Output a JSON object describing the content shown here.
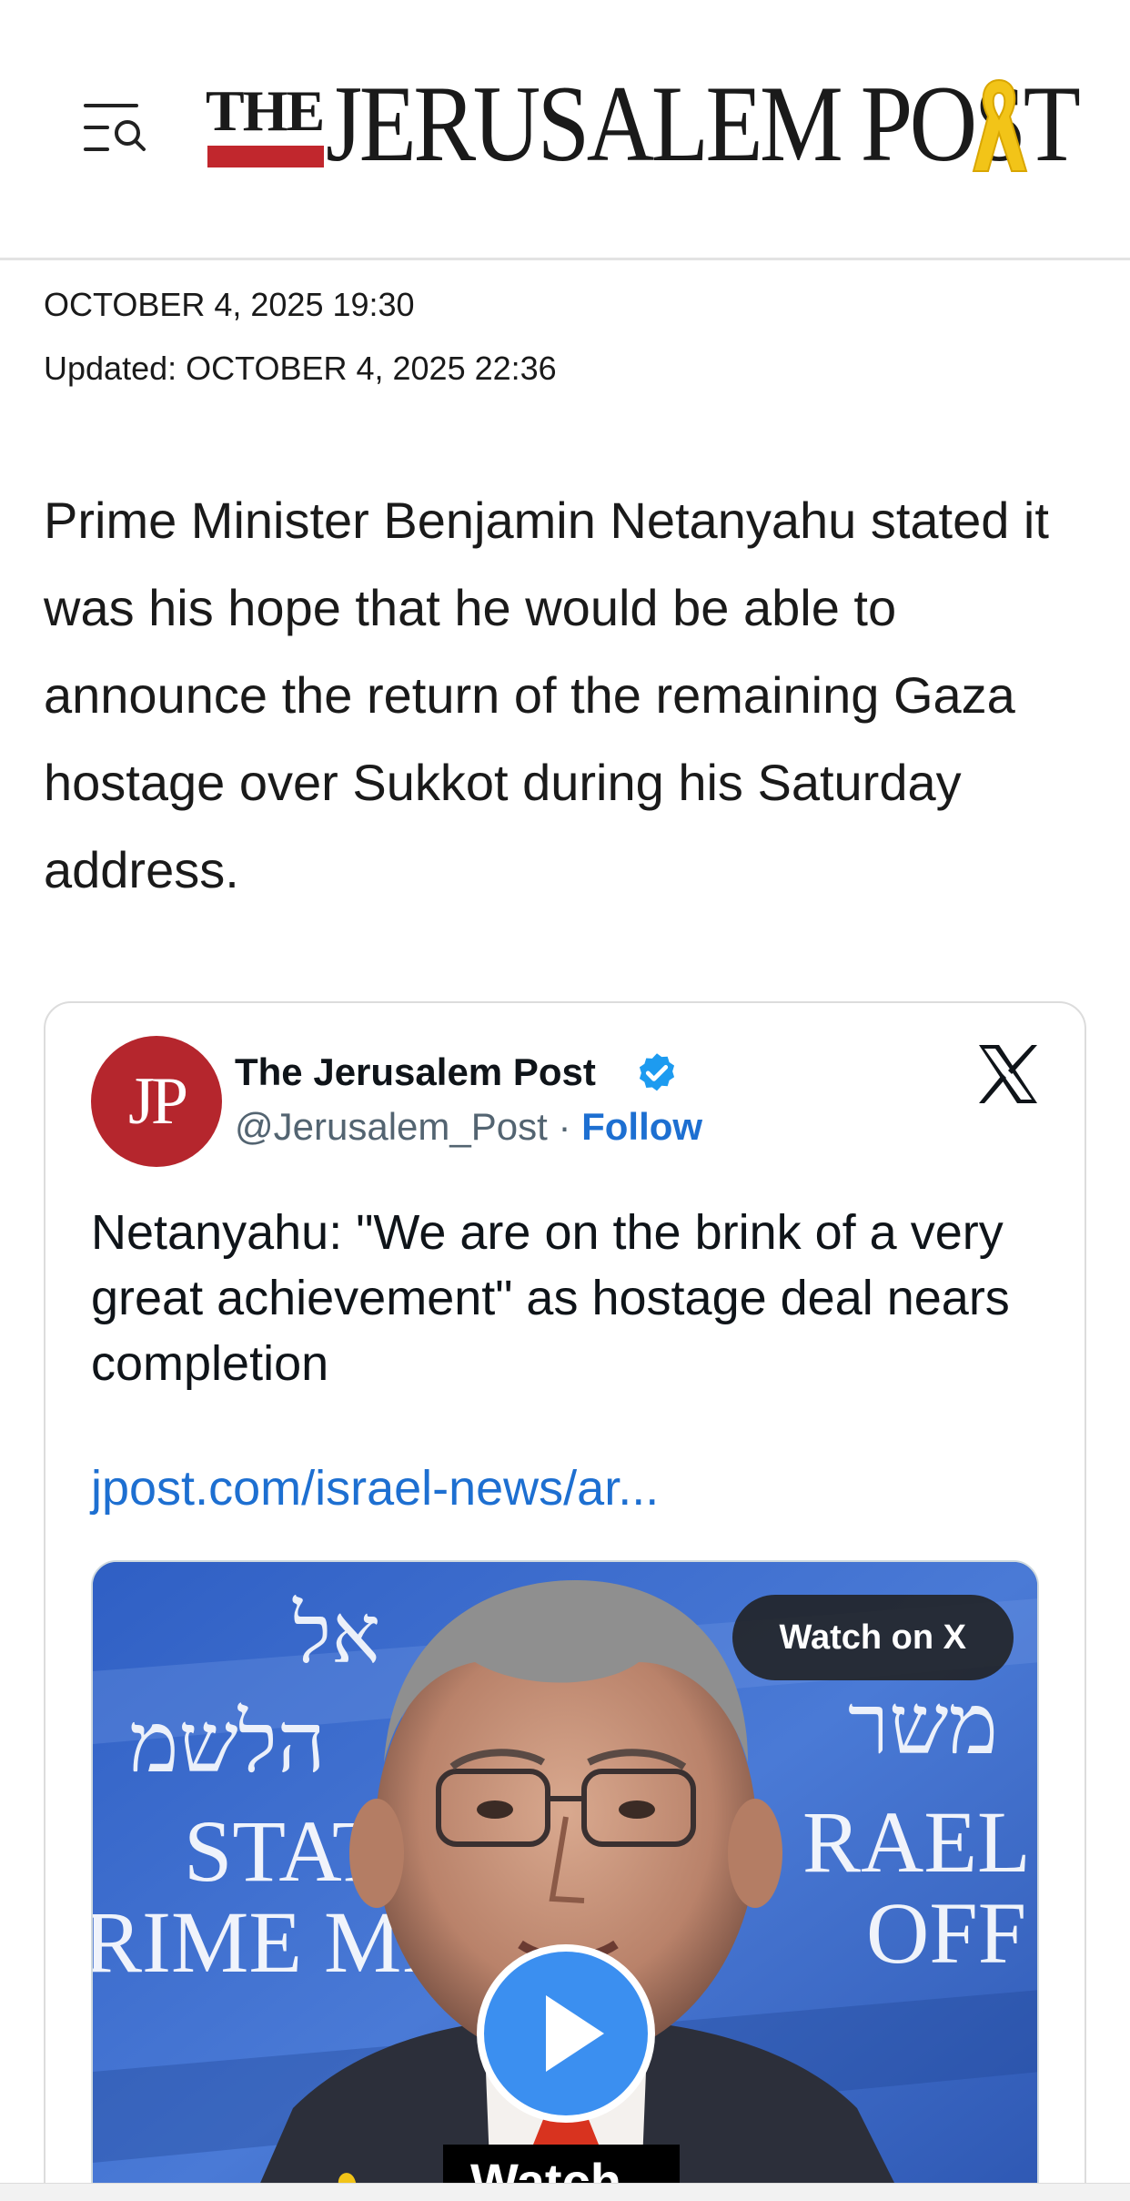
{
  "header": {
    "logo_the": "THE",
    "logo_name": "JERUSALEM POST",
    "menu_icon": "menu-search-icon",
    "ribbon_icon": "yellow-ribbon-icon",
    "brand_red": "#c1272d",
    "ribbon_color": "#f2c418"
  },
  "article": {
    "published": "OCTOBER 4, 2025 19:30",
    "updated": "Updated: OCTOBER 4, 2025 22:36",
    "lead": "Prime Minister Benjamin Netanyahu stated it was his hope that he would be able to announce the return of the remaining Gaza hostage over Sukkot during his Saturday address."
  },
  "tweet": {
    "avatar_text": "JP",
    "name": "The Jerusalem Post",
    "handle": "@Jerusalem_Post",
    "separator": " · ",
    "follow": "Follow",
    "text": "Netanyahu: \"We are on the brink of a very great achievement\" as hostage deal nears completion",
    "link": "jpost.com/israel-news/ar...",
    "watch_label": "Watch on X",
    "verified_icon": "verified-badge-icon",
    "x_icon": "x-logo-icon",
    "play_icon": "play-icon",
    "accent": "#1d6fd1",
    "video_bg": {
      "hebrew_top": "אל",
      "hebrew_left": "הלשמ",
      "hebrew_right": "משר",
      "state_left": "STATE",
      "state_right": "RAEL",
      "office_left": "RIME MI",
      "office_right": "OFF",
      "subtitle": "Watch"
    }
  }
}
